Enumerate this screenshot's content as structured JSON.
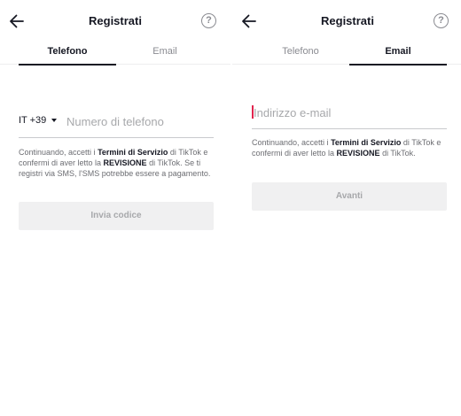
{
  "screens": [
    {
      "title": "Registrati",
      "tabs": [
        {
          "label": "Telefono",
          "active": true
        },
        {
          "label": "Email",
          "active": false
        }
      ],
      "country_code": "IT +39",
      "phone_placeholder": "Numero di telefono",
      "terms": {
        "prefix": "Continuando, accetti i ",
        "terms_link": "Termini di Servizio",
        "middle": " di TikTok e confermi di aver letto la ",
        "review_link": "REVISIONE",
        "suffix": " di TikTok. Se ti registri via SMS, l'SMS potrebbe essere a pagamento."
      },
      "button_label": "Invia codice"
    },
    {
      "title": "Registrati",
      "tabs": [
        {
          "label": "Telefono",
          "active": false
        },
        {
          "label": "Email",
          "active": true
        }
      ],
      "email_placeholder": "Indirizzo e-mail",
      "terms": {
        "prefix": "Continuando, accetti i ",
        "terms_link": "Termini di Servizio",
        "middle": " di TikTok e confermi di aver letto la ",
        "review_link": "REVISIONE",
        "suffix": " di TikTok."
      },
      "button_label": "Avanti"
    }
  ],
  "icons": {
    "back": "arrow-left-icon",
    "help": "question-circle-icon",
    "help_glyph": "?",
    "dropdown": "caret-down-icon"
  },
  "colors": {
    "text": "#161823",
    "muted": "#8a8b91",
    "placeholder": "#a7a8ab",
    "disabled_button_bg": "#f0f0f1",
    "cursor": "#e1254e"
  }
}
